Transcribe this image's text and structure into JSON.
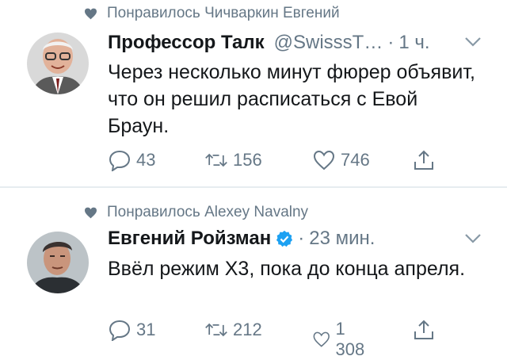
{
  "tweets": [
    {
      "liked_by": "Понравилось Чичваркин Евгений",
      "name": "Профессор Талк",
      "handle": "@SwisssT…",
      "dot": "·",
      "time": "1 ч.",
      "verified": false,
      "text": "Через несколько минут фюрер объявит, что он решил расписаться с Евой Браун.",
      "replies": "43",
      "retweets": "156",
      "likes": "746"
    },
    {
      "liked_by": "Понравилось Alexey Navalny",
      "name": "Евгений Ройзман",
      "handle": "",
      "dot": "·",
      "time": "23 мин.",
      "verified": true,
      "text": "Ввёл режим Х3, пока до конца апреля.",
      "replies": "31",
      "retweets": "212",
      "likes": "1 308"
    }
  ],
  "icons": [
    "heart-icon",
    "reply-icon",
    "retweet-icon",
    "like-icon",
    "share-icon",
    "chevron-down-icon",
    "verified-icon"
  ],
  "colors": {
    "secondary_text": "#657786",
    "primary_text": "#14171a",
    "verified": "#1da1f2",
    "divider": "#e6ecf0"
  }
}
